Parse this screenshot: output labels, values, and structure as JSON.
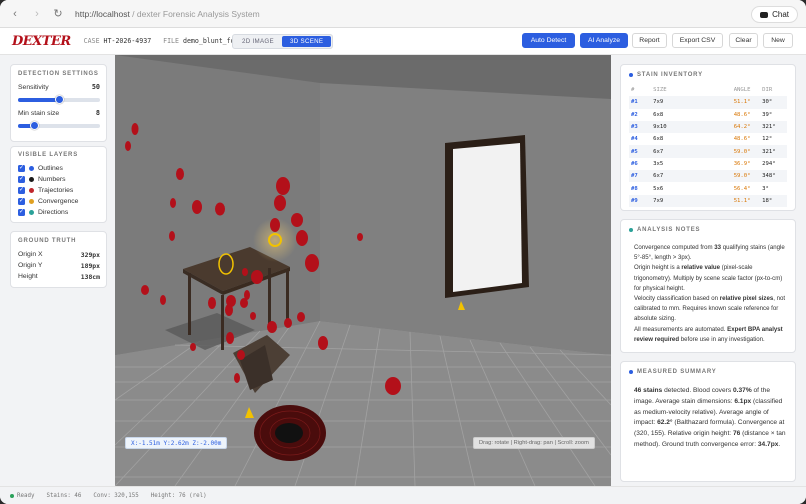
{
  "browser": {
    "url_host": "http://localhost",
    "url_sep": " / ",
    "url_title": "dexter Forensic Analysis System",
    "chat_label": "Chat"
  },
  "app": {
    "logo": "DEXTER",
    "case_label": "CASE",
    "case_id": "HT-2026-4937",
    "file_label": "FILE",
    "file_name": "demo_blunt_force.png"
  },
  "view_toggle": {
    "image2d": "2D IMAGE",
    "scene3d": "3D SCENE",
    "active": "3D SCENE"
  },
  "toolbar": {
    "auto_detect": "Auto Detect",
    "ai_analyze": "AI Analyze",
    "report": "Report",
    "export_csv": "Export CSV",
    "clear": "Clear",
    "new": "New"
  },
  "detection": {
    "title": "DETECTION SETTINGS",
    "sensitivity_label": "Sensitivity",
    "sensitivity_value": "50",
    "sensitivity_fraction": 0.5,
    "min_size_label": "Min stain size",
    "min_size_value": "8",
    "min_size_fraction": 0.2
  },
  "layers": {
    "title": "VISIBLE LAYERS",
    "items": [
      {
        "label": "Outlines",
        "color": "#2c5ee0"
      },
      {
        "label": "Numbers",
        "color": "#1a1a1a"
      },
      {
        "label": "Trajectories",
        "color": "#c0262b"
      },
      {
        "label": "Convergence",
        "color": "#e0a020"
      },
      {
        "label": "Directions",
        "color": "#2aa198"
      }
    ]
  },
  "ground_truth": {
    "title": "GROUND TRUTH",
    "rows": [
      {
        "label": "Origin X",
        "value": "329px"
      },
      {
        "label": "Origin Y",
        "value": "189px"
      },
      {
        "label": "Height",
        "value": "138cm"
      }
    ]
  },
  "viewport": {
    "coords": "X:-1.51m Y:2.62m Z:-2.00m",
    "hint": "Drag: rotate | Right-drag: pan | Scroll: zoom"
  },
  "inventory": {
    "title": "STAIN INVENTORY",
    "headers": [
      "#",
      "SIZE",
      "ANGLE",
      "DIR"
    ],
    "rows": [
      {
        "id": "#1",
        "size": "7x9",
        "angle": "51.1°",
        "dir": "30°"
      },
      {
        "id": "#2",
        "size": "6x8",
        "angle": "48.6°",
        "dir": "39°"
      },
      {
        "id": "#3",
        "size": "9x10",
        "angle": "64.2°",
        "dir": "321°"
      },
      {
        "id": "#4",
        "size": "6x8",
        "angle": "48.6°",
        "dir": "12°"
      },
      {
        "id": "#5",
        "size": "6x7",
        "angle": "59.0°",
        "dir": "321°"
      },
      {
        "id": "#6",
        "size": "3x5",
        "angle": "36.9°",
        "dir": "294°"
      },
      {
        "id": "#7",
        "size": "6x7",
        "angle": "59.0°",
        "dir": "348°"
      },
      {
        "id": "#8",
        "size": "5x6",
        "angle": "56.4°",
        "dir": "3°"
      },
      {
        "id": "#9",
        "size": "7x9",
        "angle": "51.1°",
        "dir": "18°"
      }
    ]
  },
  "notes": {
    "title": "ANALYSIS NOTES",
    "p1a": "Convergence computed from ",
    "p1b": "33",
    "p1c": " qualifying stains (angle 5°-85°, length > 3px).",
    "p2a": "Origin height is a ",
    "p2b": "relative value",
    "p2c": " (pixel-scale trigonometry). Multiply by scene scale factor (px-to-cm) for physical height.",
    "p3a": "Velocity classification based on ",
    "p3b": "relative pixel sizes",
    "p3c": ", not calibrated to mm. Requires known scale reference for absolute sizing.",
    "p4a": "All measurements are automated. ",
    "p4b": "Expert BPA analyst review required",
    "p4c": " before use in any investigation."
  },
  "summary": {
    "title": "MEASURED SUMMARY",
    "s1": "46 stains",
    "s2": " detected. Blood covers ",
    "s3": "0.37%",
    "s4": " of the image. Average stain dimensions: ",
    "s5": "6.1px",
    "s6": " (classified as medium-velocity relative). Average angle of impact: ",
    "s7": "62.2°",
    "s8": " (Balthazard formula). Convergence at (320, 155). Relative origin height: ",
    "s9": "76",
    "s10": " (distance × tan method). Ground truth convergence error: ",
    "s11": "34.7px",
    "s12": "."
  },
  "status": {
    "ready": "Ready",
    "stains": "Stains: 46",
    "conv": "Conv: 320,155",
    "height": "Height: 76 (rel)"
  }
}
